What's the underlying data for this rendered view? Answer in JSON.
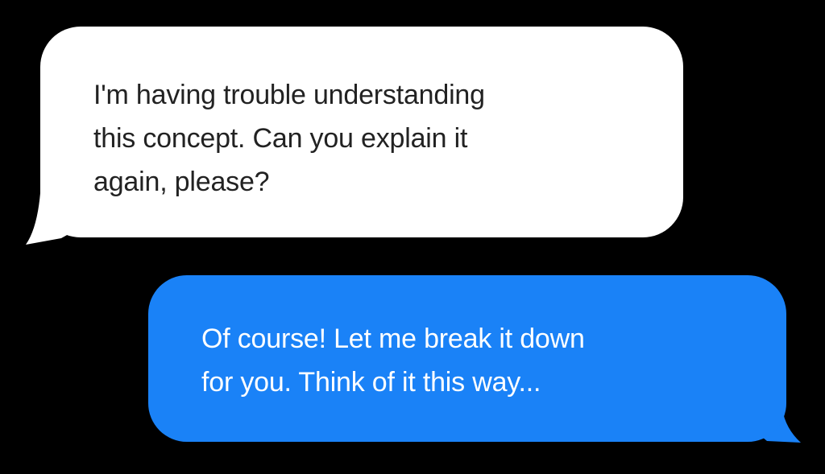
{
  "colors": {
    "background": "#000000",
    "incoming_bubble": "#ffffff",
    "incoming_text": "#222222",
    "outgoing_bubble": "#1a82f7",
    "outgoing_text": "#ffffff"
  },
  "messages": [
    {
      "direction": "incoming",
      "lines": [
        "I'm having trouble understanding",
        "this concept. Can you explain it",
        "again, please?"
      ]
    },
    {
      "direction": "outgoing",
      "lines": [
        "Of course! Let me break it down",
        "for you. Think of it this way..."
      ]
    }
  ]
}
